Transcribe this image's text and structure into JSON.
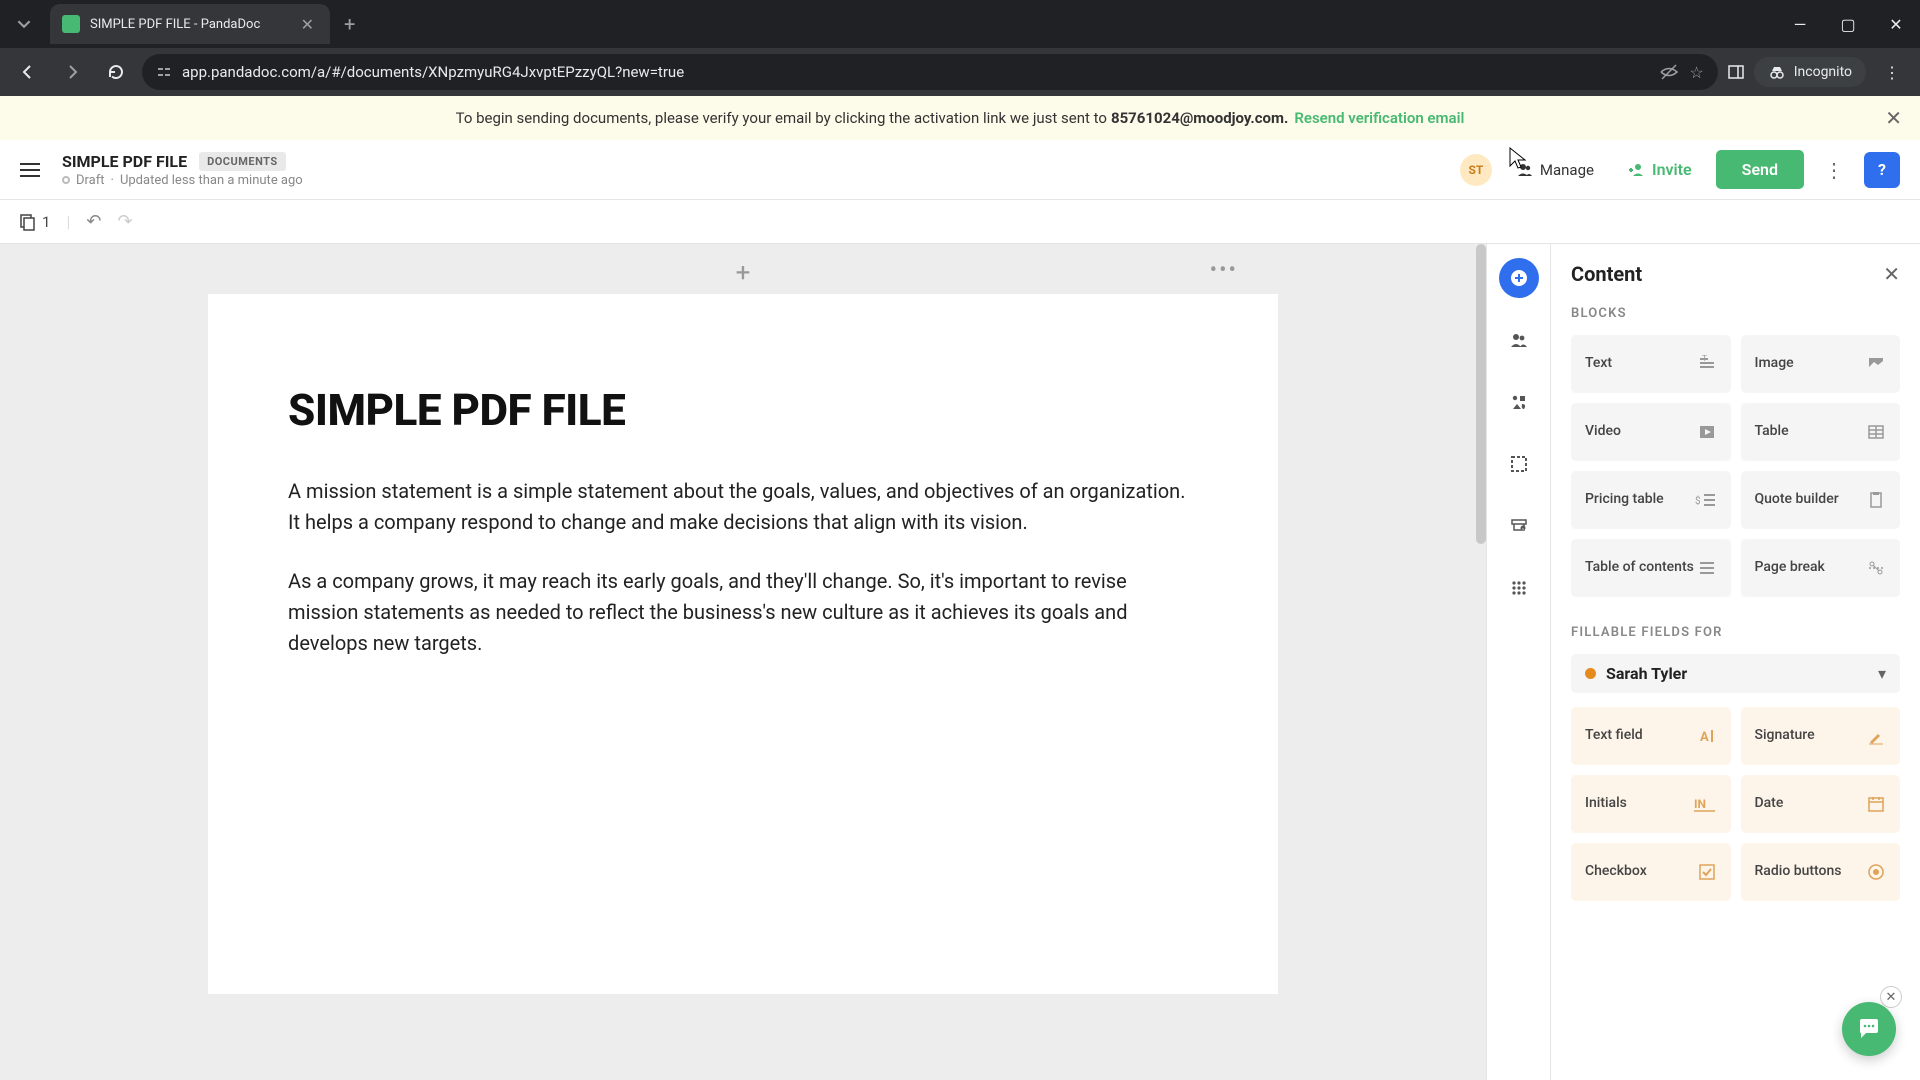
{
  "browser": {
    "tab_title": "SIMPLE PDF FILE - PandaDoc",
    "url": "app.pandadoc.com/a/#/documents/XNpzmyuRG4JxvptEPzzyQL?new=true",
    "incognito_label": "Incognito"
  },
  "banner": {
    "text_pre": "To begin sending documents, please verify your email by clicking the activation link we just sent to ",
    "email": "85761024@moodjoy.com.",
    "resend": "Resend verification email"
  },
  "header": {
    "title": "SIMPLE PDF FILE",
    "badge": "DOCUMENTS",
    "status": "Draft",
    "updated": "Updated less than a minute ago",
    "avatar_initials": "ST",
    "manage": "Manage",
    "invite": "Invite",
    "send": "Send"
  },
  "toolbar": {
    "page_count": "1"
  },
  "document": {
    "heading": "SIMPLE PDF FILE",
    "p1": "A mission statement is a simple statement about the goals, values, and objectives of an organization. It helps a company respond to change and make decisions that align with its vision.",
    "p2": "As a company grows, it may reach its early goals, and they'll change. So, it's important to revise mission statements as needed to reflect the business's new culture as it achieves its goals and develops new targets."
  },
  "panel": {
    "title": "Content",
    "section_blocks": "BLOCKS",
    "blocks": {
      "text": "Text",
      "image": "Image",
      "video": "Video",
      "table": "Table",
      "pricing": "Pricing table",
      "quote": "Quote builder",
      "toc": "Table of contents",
      "pagebreak": "Page break"
    },
    "section_fields": "FILLABLE FIELDS FOR",
    "signer": "Sarah Tyler",
    "fields": {
      "text_field": "Text field",
      "signature": "Signature",
      "initials": "Initials",
      "date": "Date",
      "checkbox": "Checkbox",
      "radio": "Radio buttons"
    }
  }
}
